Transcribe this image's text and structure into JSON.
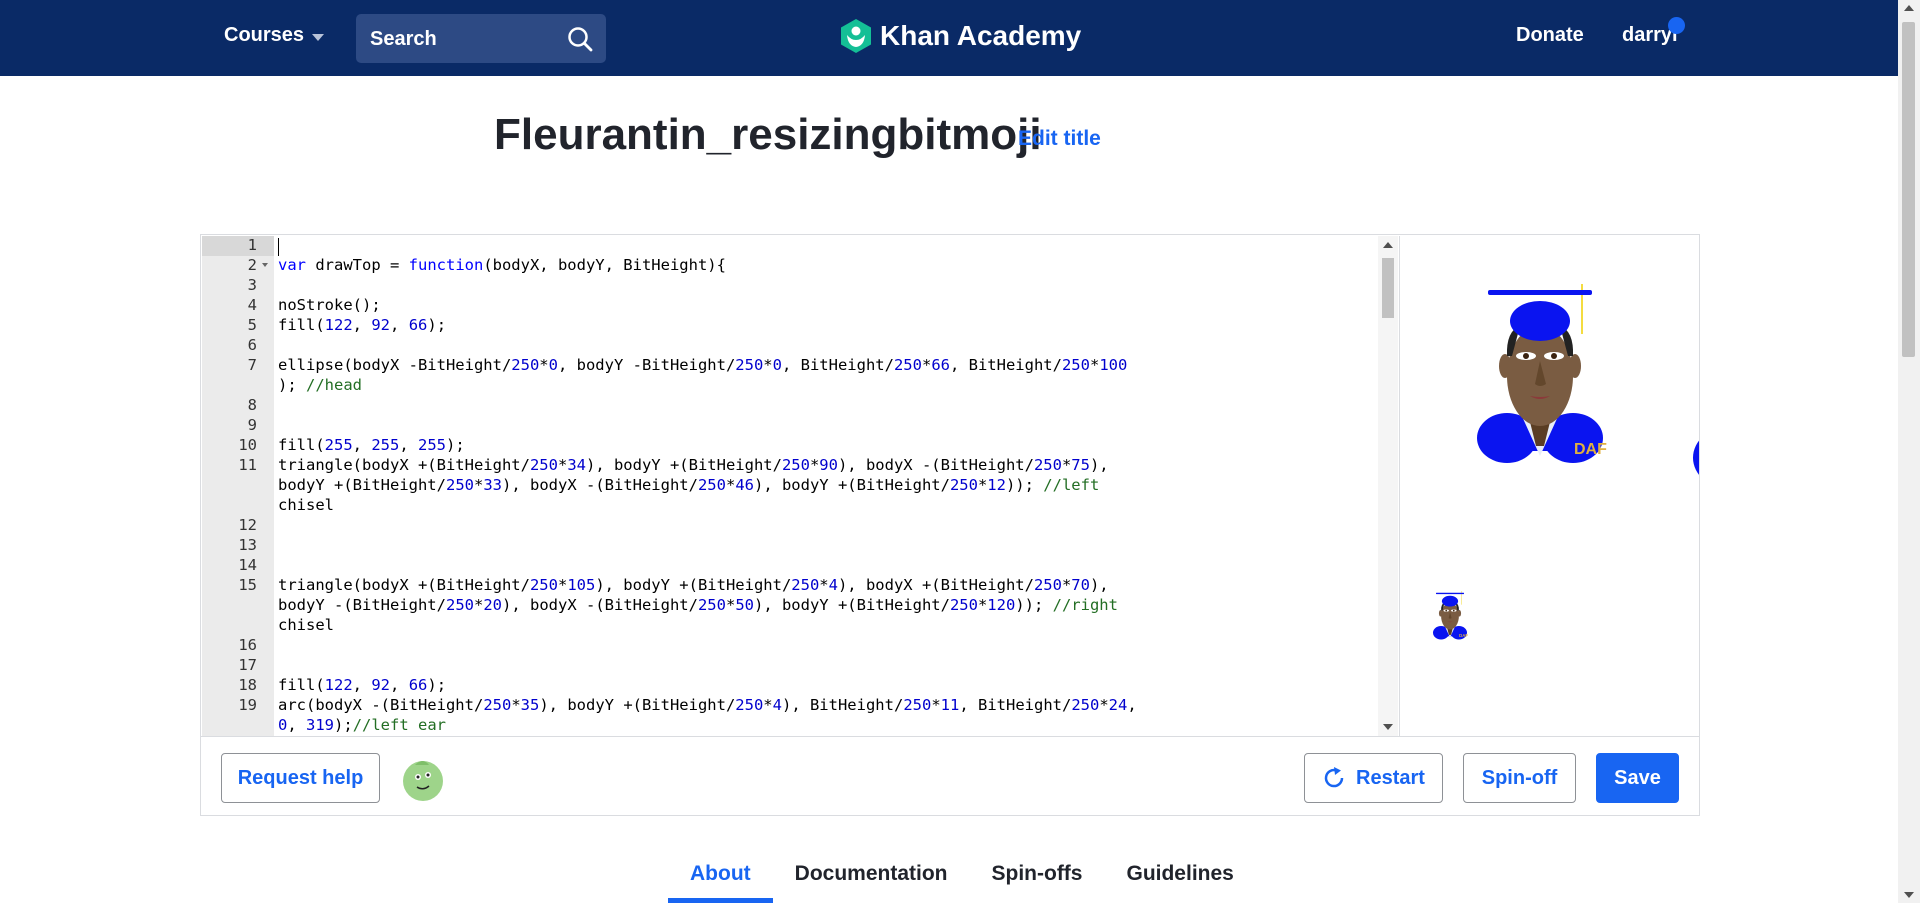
{
  "header": {
    "courses_label": "Courses",
    "search_placeholder": "Search",
    "logo_text": "Khan Academy",
    "donate_label": "Donate",
    "username": "darryl"
  },
  "program": {
    "title": "Fleurantin_resizingbitmoji",
    "edit_title_label": "Edit title"
  },
  "code_lines": [
    {
      "num": "1",
      "text": ""
    },
    {
      "num": "2",
      "text": "var drawTop = function(bodyX, bodyY, BitHeight){"
    },
    {
      "num": "3",
      "text": ""
    },
    {
      "num": "4",
      "text": "noStroke();"
    },
    {
      "num": "5",
      "text": "fill(122, 92, 66);"
    },
    {
      "num": "6",
      "text": ""
    },
    {
      "num": "7",
      "text": "ellipse(bodyX -BitHeight/250*0, bodyY -BitHeight/250*0, BitHeight/250*66, BitHeight/250*100"
    },
    {
      "num": "",
      "text": "); //head"
    },
    {
      "num": "8",
      "text": ""
    },
    {
      "num": "9",
      "text": ""
    },
    {
      "num": "10",
      "text": "fill(255, 255, 255);"
    },
    {
      "num": "11",
      "text": "triangle(bodyX +(BitHeight/250*34), bodyY +(BitHeight/250*90), bodyX -(BitHeight/250*75),"
    },
    {
      "num": "",
      "text": "bodyY +(BitHeight/250*33), bodyX -(BitHeight/250*46), bodyY +(BitHeight/250*12)); //left"
    },
    {
      "num": "",
      "text": "chisel"
    },
    {
      "num": "12",
      "text": ""
    },
    {
      "num": "13",
      "text": ""
    },
    {
      "num": "14",
      "text": ""
    },
    {
      "num": "15",
      "text": "triangle(bodyX +(BitHeight/250*105), bodyY +(BitHeight/250*4), bodyX +(BitHeight/250*70),"
    },
    {
      "num": "",
      "text": "bodyY -(BitHeight/250*20), bodyX -(BitHeight/250*50), bodyY +(BitHeight/250*120)); //right"
    },
    {
      "num": "",
      "text": "chisel"
    },
    {
      "num": "16",
      "text": ""
    },
    {
      "num": "17",
      "text": ""
    },
    {
      "num": "18",
      "text": "fill(122, 92, 66);"
    },
    {
      "num": "19",
      "text": "arc(bodyX -(BitHeight/250*35), bodyY +(BitHeight/250*4), BitHeight/250*11, BitHeight/250*24,"
    },
    {
      "num": "",
      "text": "0, 319);//left ear"
    }
  ],
  "canvas": {
    "badge_text": "DAF"
  },
  "buttons": {
    "request_help": "Request help",
    "restart": "Restart",
    "spin_off": "Spin-off",
    "save": "Save"
  },
  "tabs": [
    {
      "label": "About",
      "active": true
    },
    {
      "label": "Documentation",
      "active": false
    },
    {
      "label": "Spin-offs",
      "active": false
    },
    {
      "label": "Guidelines",
      "active": false
    }
  ],
  "colors": {
    "header_bg": "#0a2a66",
    "accent": "#1865f2",
    "cap_blue": "#0a14f0",
    "skin": "#7a5c42"
  }
}
